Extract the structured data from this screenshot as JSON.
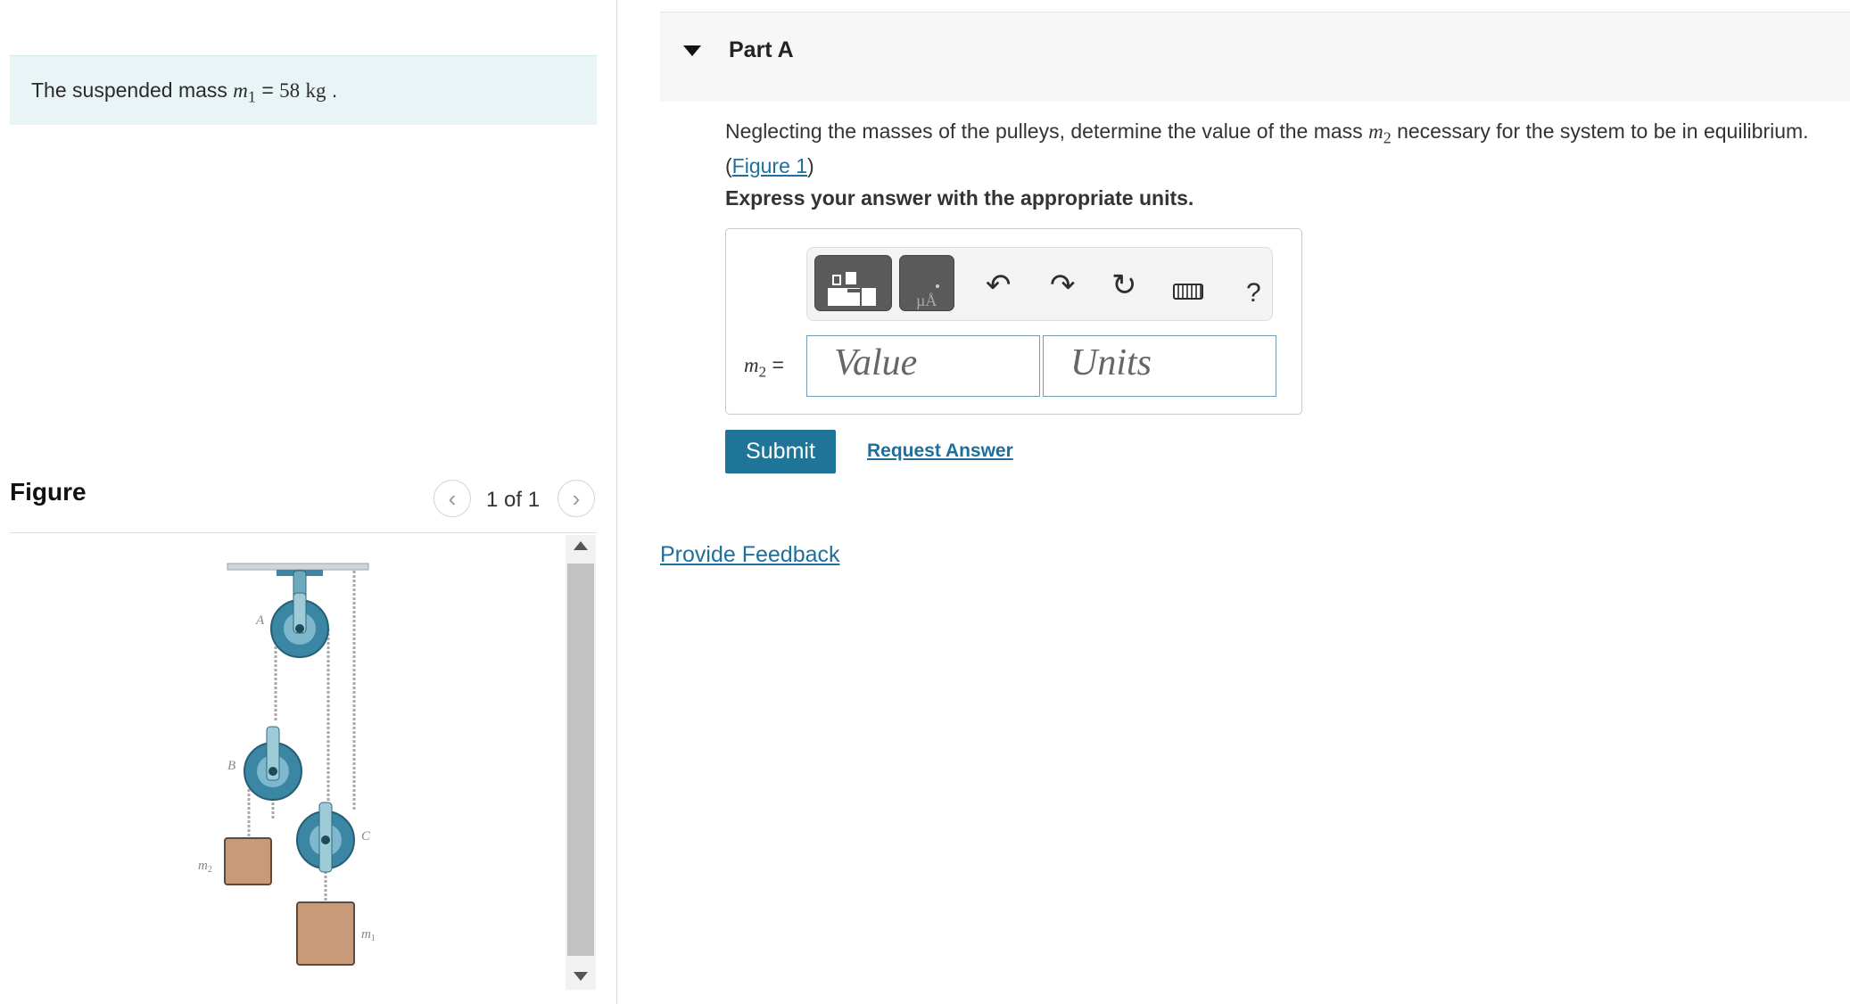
{
  "intro": {
    "text": "The suspended mass",
    "var": "m",
    "sub": "1",
    "equals": "=",
    "value": "58",
    "unit": "kg",
    "period": "."
  },
  "figure_panel": {
    "title": "Figure",
    "pager": "1 of 1",
    "prev_icon": "chevron-left-icon",
    "next_icon": "chevron-right-icon",
    "labels": {
      "a": "A",
      "b": "B",
      "c": "C",
      "m2": "m",
      "m2_sub": "2",
      "m1": "m",
      "m1_sub": "1"
    },
    "colors": {
      "pulley": "#3a86a3",
      "mass": "#c99a7a",
      "rope": "#a8a8a8"
    }
  },
  "part": {
    "title": "Part A",
    "question_before": "Neglecting the masses of the pulleys, determine the value of the mass",
    "question_var": "m",
    "question_sub": "2",
    "question_after": "necessary for the system to be in equilibrium.",
    "figure_link": "Figure 1",
    "instruction": "Express your answer with the appropriate units."
  },
  "answer": {
    "var": "m",
    "sub": "2",
    "equals": "=",
    "value_placeholder": "Value",
    "units_placeholder": "Units",
    "toolbar_icons": [
      "templates-icon",
      "units-icon",
      "undo-icon",
      "redo-icon",
      "reset-icon",
      "keyboard-icon",
      "help-icon"
    ],
    "help_symbol": "?"
  },
  "actions": {
    "submit": "Submit",
    "request_answer": "Request Answer",
    "feedback": "Provide Feedback"
  },
  "colors": {
    "accent": "#1f7597",
    "link": "#1f6f9c",
    "intro_bg": "#e9f4f6"
  }
}
